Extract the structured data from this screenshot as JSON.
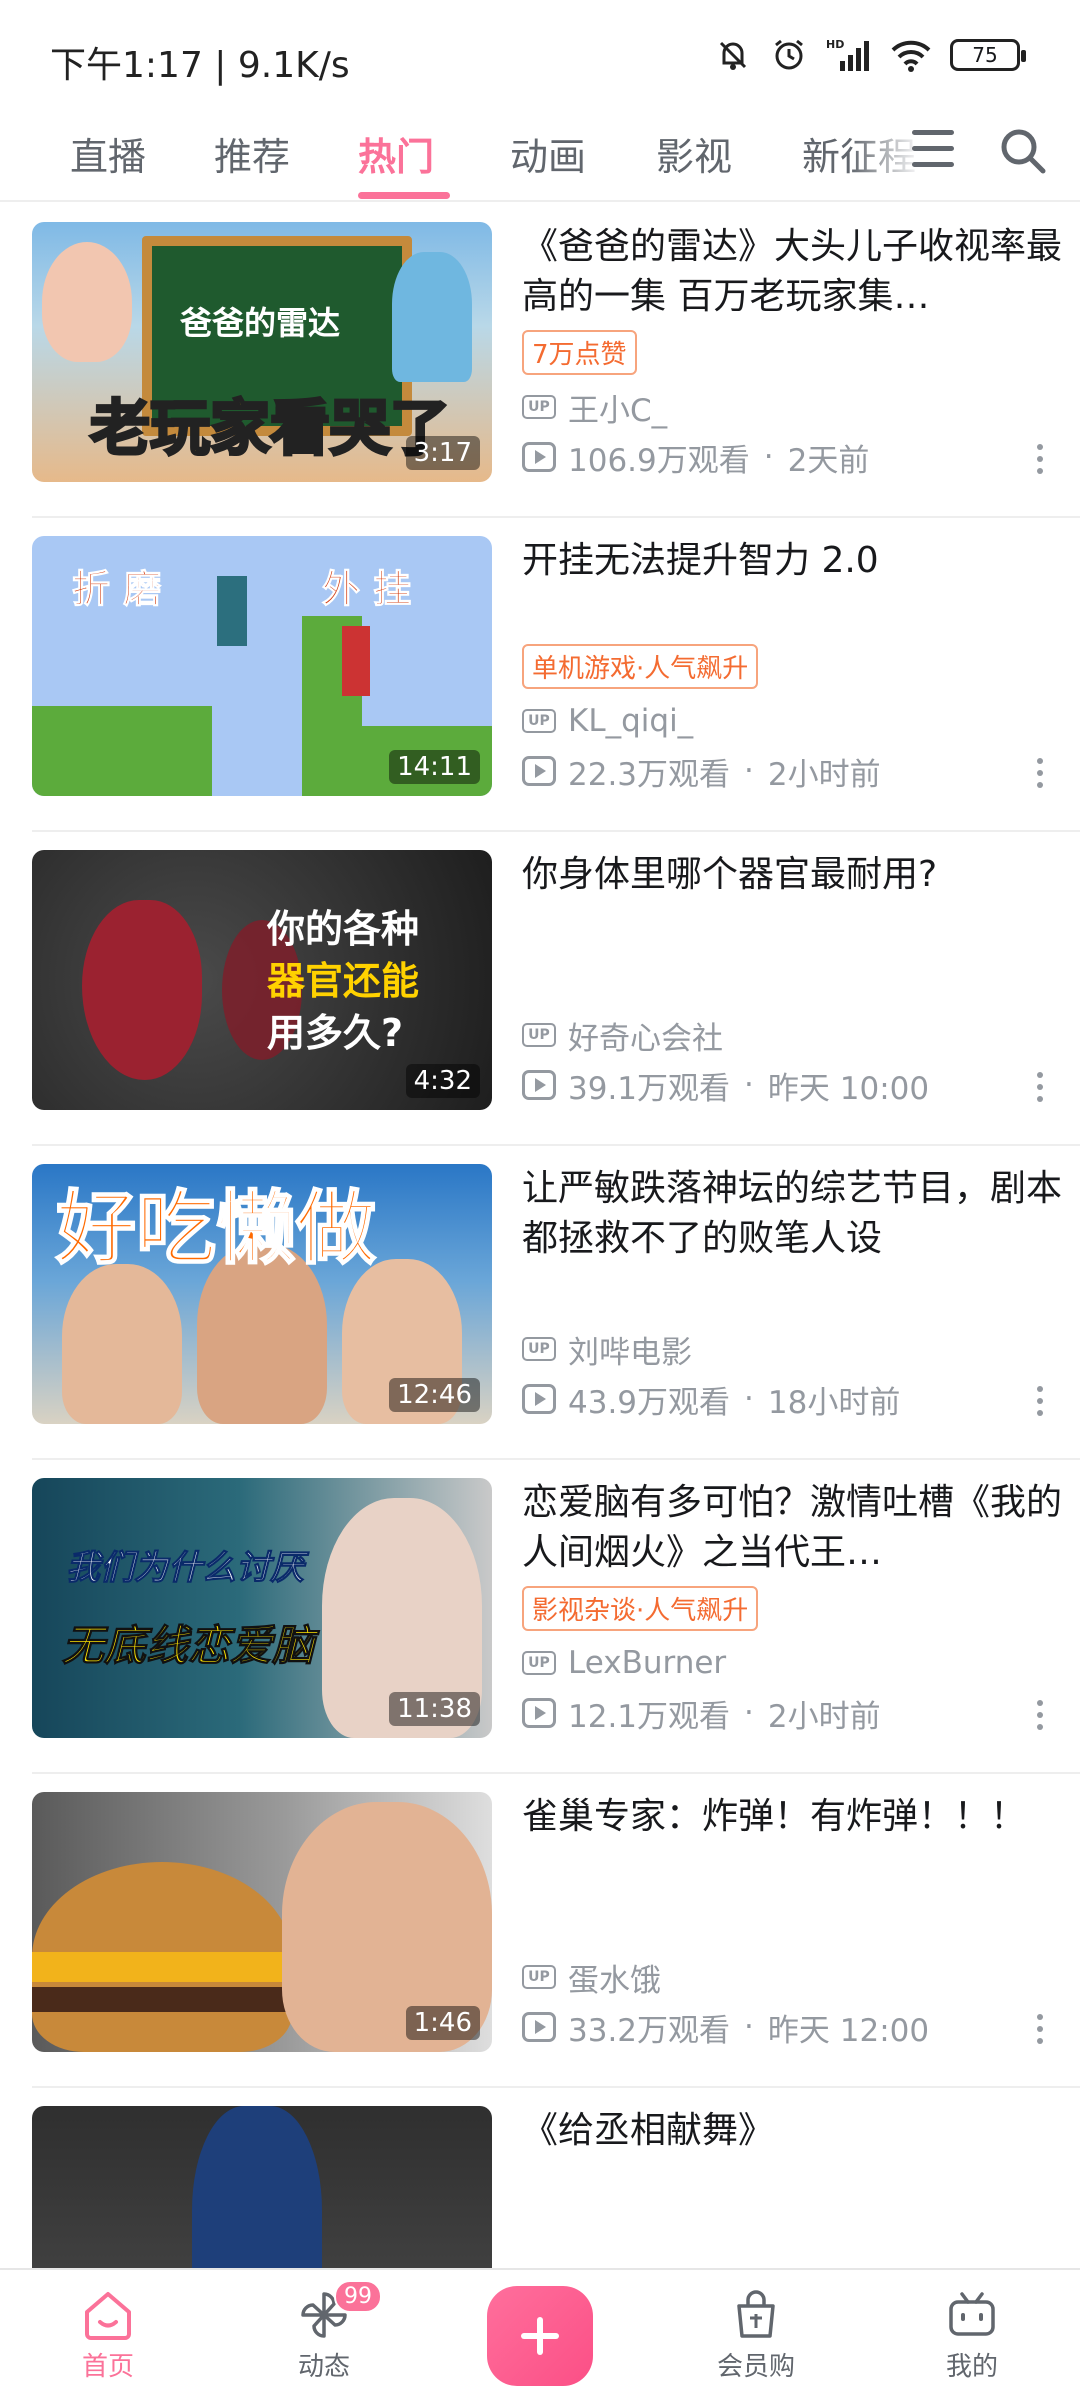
{
  "status": {
    "time": "下午1:17 | 9.1K/s",
    "battery": "75"
  },
  "tabs": [
    {
      "label": "直播"
    },
    {
      "label": "推荐"
    },
    {
      "label": "热门"
    },
    {
      "label": "动画"
    },
    {
      "label": "影视"
    },
    {
      "label": "新征程"
    }
  ],
  "active_tab": "热门",
  "feed": [
    {
      "title": "《爸爸的雷达》大头儿子收视率最高的一集 百万老玩家集…",
      "badge": "7万点赞",
      "up": "王小C_",
      "views": "106.9万观看",
      "time": "2天前",
      "duration": "3:17",
      "thumb_text_1": "爸爸的雷达",
      "thumb_text_2": "老玩家看哭了"
    },
    {
      "title": "开挂无法提升智力 2.0",
      "badge": "单机游戏·人气飙升",
      "up": "KL_qiqi_",
      "views": "22.3万观看",
      "time": "2小时前",
      "duration": "14:11",
      "thumb_text_1": "折 磨",
      "thumb_text_2": "外 挂"
    },
    {
      "title": "你身体里哪个器官最耐用?",
      "badge": "",
      "up": "好奇心会社",
      "views": "39.1万观看",
      "time": "昨天 10:00",
      "duration": "4:32",
      "thumb_text_1": "你的各种",
      "thumb_text_2": "器官还能",
      "thumb_text_3": "用多久?"
    },
    {
      "title": "让严敏跌落神坛的综艺节目，剧本都拯救不了的败笔人设",
      "badge": "",
      "up": "刘哔电影",
      "views": "43.9万观看",
      "time": "18小时前",
      "duration": "12:46",
      "thumb_text_1": "好吃懒做"
    },
    {
      "title": "恋爱脑有多可怕？激情吐槽《我的人间烟火》之当代王…",
      "badge": "影视杂谈·人气飙升",
      "up": "LexBurner",
      "views": "12.1万观看",
      "time": "2小时前",
      "duration": "11:38",
      "thumb_text_1": "我们为什么讨厌",
      "thumb_text_2": "无底线恋爱脑"
    },
    {
      "title": "雀巢专家：炸弹！有炸弹！！！",
      "badge": "",
      "up": "蛋水饿",
      "views": "33.2万观看",
      "time": "昨天 12:00",
      "duration": "1:46"
    },
    {
      "title": "《给丞相献舞》",
      "badge": "",
      "up": "",
      "views": "",
      "time": "",
      "duration": ""
    }
  ],
  "nav": {
    "home": "首页",
    "dynamic": "动态",
    "dynamic_badge": "99",
    "vip_shop": "会员购",
    "mine": "我的"
  },
  "colors": {
    "accent": "#fb7299",
    "badge_text": "#f46b31",
    "meta_gray": "#9499a0"
  }
}
